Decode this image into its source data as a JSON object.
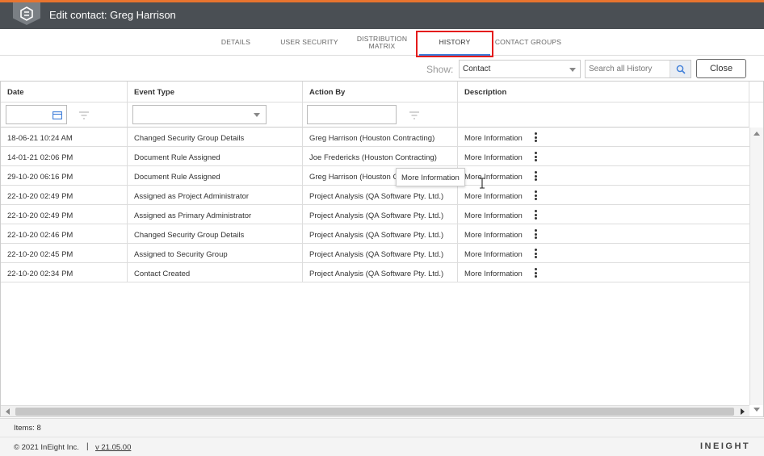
{
  "window": {
    "title": "Edit contact: Greg Harrison"
  },
  "tabs": [
    {
      "label": "DETAILS",
      "active": false
    },
    {
      "label": "USER SECURITY",
      "active": false
    },
    {
      "label": "DISTRIBUTION\nMATRIX",
      "active": false
    },
    {
      "label": "HISTORY",
      "active": true
    },
    {
      "label": "CONTACT GROUPS",
      "active": false
    }
  ],
  "toolbar": {
    "show_label": "Show:",
    "show_value": "Contact",
    "search_placeholder": "Search all History",
    "close_label": "Close"
  },
  "grid": {
    "columns": [
      "Date",
      "Event Type",
      "Action By",
      "Description"
    ],
    "rows": [
      {
        "date": "18-06-21 10:24 AM",
        "event": "Changed Security Group Details",
        "by": "Greg Harrison (Houston Contracting)",
        "desc": "More Information"
      },
      {
        "date": "14-01-21 02:06 PM",
        "event": "Document Rule Assigned",
        "by": "Joe Fredericks (Houston Contracting)",
        "desc": "More Information"
      },
      {
        "date": "29-10-20 06:16 PM",
        "event": "Document Rule Assigned",
        "by": "Greg Harrison (Houston C",
        "desc": "More Information"
      },
      {
        "date": "22-10-20 02:49 PM",
        "event": "Assigned as Project Administrator",
        "by": "Project Analysis (QA Software Pty. Ltd.)",
        "desc": "More Information"
      },
      {
        "date": "22-10-20 02:49 PM",
        "event": "Assigned as Primary Administrator",
        "by": "Project Analysis (QA Software Pty. Ltd.)",
        "desc": "More Information"
      },
      {
        "date": "22-10-20 02:46 PM",
        "event": "Changed Security Group Details",
        "by": "Project Analysis (QA Software Pty. Ltd.)",
        "desc": "More Information"
      },
      {
        "date": "22-10-20 02:45 PM",
        "event": "Assigned to Security Group",
        "by": "Project Analysis (QA Software Pty. Ltd.)",
        "desc": "More Information"
      },
      {
        "date": "22-10-20 02:34 PM",
        "event": "Contact Created",
        "by": "Project Analysis (QA Software Pty. Ltd.)",
        "desc": "More Information"
      }
    ],
    "tooltip": "More Information"
  },
  "status": {
    "items_count": "Items: 8"
  },
  "footer": {
    "copyright": "© 2021 InEight Inc.",
    "separator": "|",
    "version": "v 21.05.00",
    "brand": "INEIGHT"
  },
  "colors": {
    "accent": "#e8742f",
    "titlebar": "#4a4f54",
    "active_tab": "#3c7dd9",
    "highlight": "#e41b1b"
  }
}
